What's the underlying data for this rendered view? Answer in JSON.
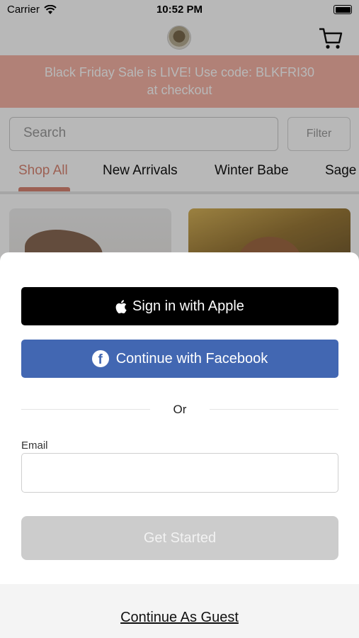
{
  "status_bar": {
    "carrier": "Carrier",
    "time": "10:52 PM"
  },
  "promo": {
    "line1": "Black Friday Sale is LIVE! Use code: BLKFRI30",
    "line2": "at checkout"
  },
  "search": {
    "placeholder": "Search",
    "filter_label": "Filter"
  },
  "tabs": [
    {
      "label": "Shop All",
      "active": true
    },
    {
      "label": "New Arrivals"
    },
    {
      "label": "Winter Babe"
    },
    {
      "label": "Sage"
    }
  ],
  "sheet": {
    "apple_label": "Sign in with Apple",
    "facebook_label": "Continue with Facebook",
    "divider_text": "Or",
    "email_label": "Email",
    "email_value": "",
    "get_started_label": "Get Started",
    "guest_label": "Continue As Guest"
  },
  "colors": {
    "promo_bg": "#f5b3a5",
    "accent": "#d98673",
    "facebook": "#4267b2",
    "apple": "#000000",
    "disabled_button": "#cccccc"
  },
  "icons": [
    "wifi-icon",
    "battery-icon",
    "cart-icon",
    "apple-logo-icon",
    "facebook-logo-icon"
  ]
}
